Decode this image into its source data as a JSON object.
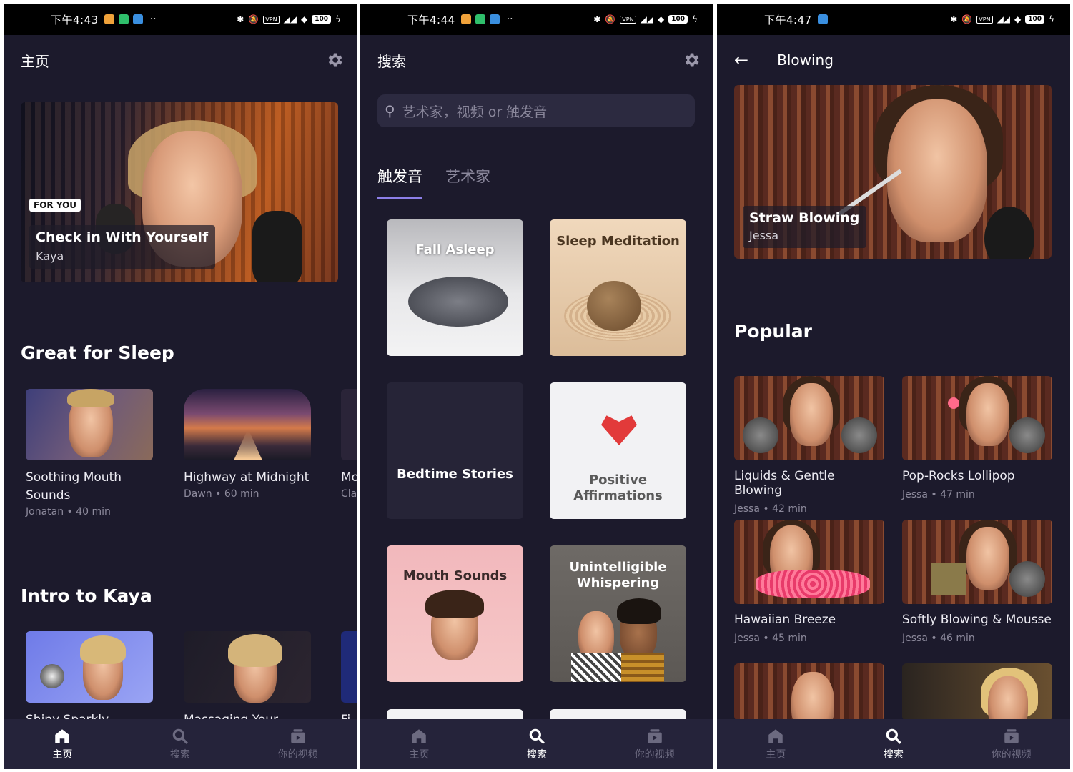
{
  "status": {
    "screen1_time": "下午4:43",
    "screen2_time": "下午4:44",
    "screen3_time": "下午4:47",
    "vpn": "VPN",
    "battery": "100"
  },
  "home": {
    "title": "主页",
    "hero": {
      "badge": "FOR YOU",
      "title": "Check in With Yourself",
      "artist": "Kaya"
    },
    "sleep_section": "Great for Sleep",
    "sleep_cards": [
      {
        "title": "Soothing Mouth Sounds",
        "sub": "Jonatan • 40 min"
      },
      {
        "title": "Highway at Midnight",
        "sub": "Dawn • 60 min"
      },
      {
        "title": "Mo Gl",
        "sub": "Cla"
      }
    ],
    "kaya_section": "Intro to Kaya",
    "kaya_cards": [
      {
        "title": "Shiny Sparkly Tingles"
      },
      {
        "title": "Massaging Your Brain"
      },
      {
        "title": "Fi"
      }
    ]
  },
  "search": {
    "title": "搜索",
    "placeholder": "艺术家，视频 or 触发音",
    "tabs": [
      "触发音",
      "艺术家"
    ],
    "tiles": [
      {
        "label": "Fall Asleep"
      },
      {
        "label": "Sleep Meditation"
      },
      {
        "label": "Bedtime Stories"
      },
      {
        "label": "Positive Affirmations"
      },
      {
        "label": "Mouth Sounds"
      },
      {
        "label": "Unintelligible Whispering"
      }
    ]
  },
  "detail": {
    "title": "Blowing",
    "hero": {
      "title": "Straw Blowing",
      "artist": "Jessa"
    },
    "popular_section": "Popular",
    "cards": [
      {
        "title": "Liquids & Gentle Blowing",
        "sub": "Jessa • 42 min"
      },
      {
        "title": "Pop-Rocks Lollipop",
        "sub": "Jessa • 47 min"
      },
      {
        "title": "Hawaiian Breeze",
        "sub": "Jessa • 45 min"
      },
      {
        "title": "Softly Blowing & Mousse",
        "sub": "Jessa • 46 min"
      }
    ]
  },
  "nav": {
    "home": "主页",
    "search": "搜索",
    "videos": "你的视频"
  },
  "colors": {
    "background": "#1c1a2c",
    "tab_accent": "#8d7fe8",
    "nav_background": "#25233a"
  }
}
